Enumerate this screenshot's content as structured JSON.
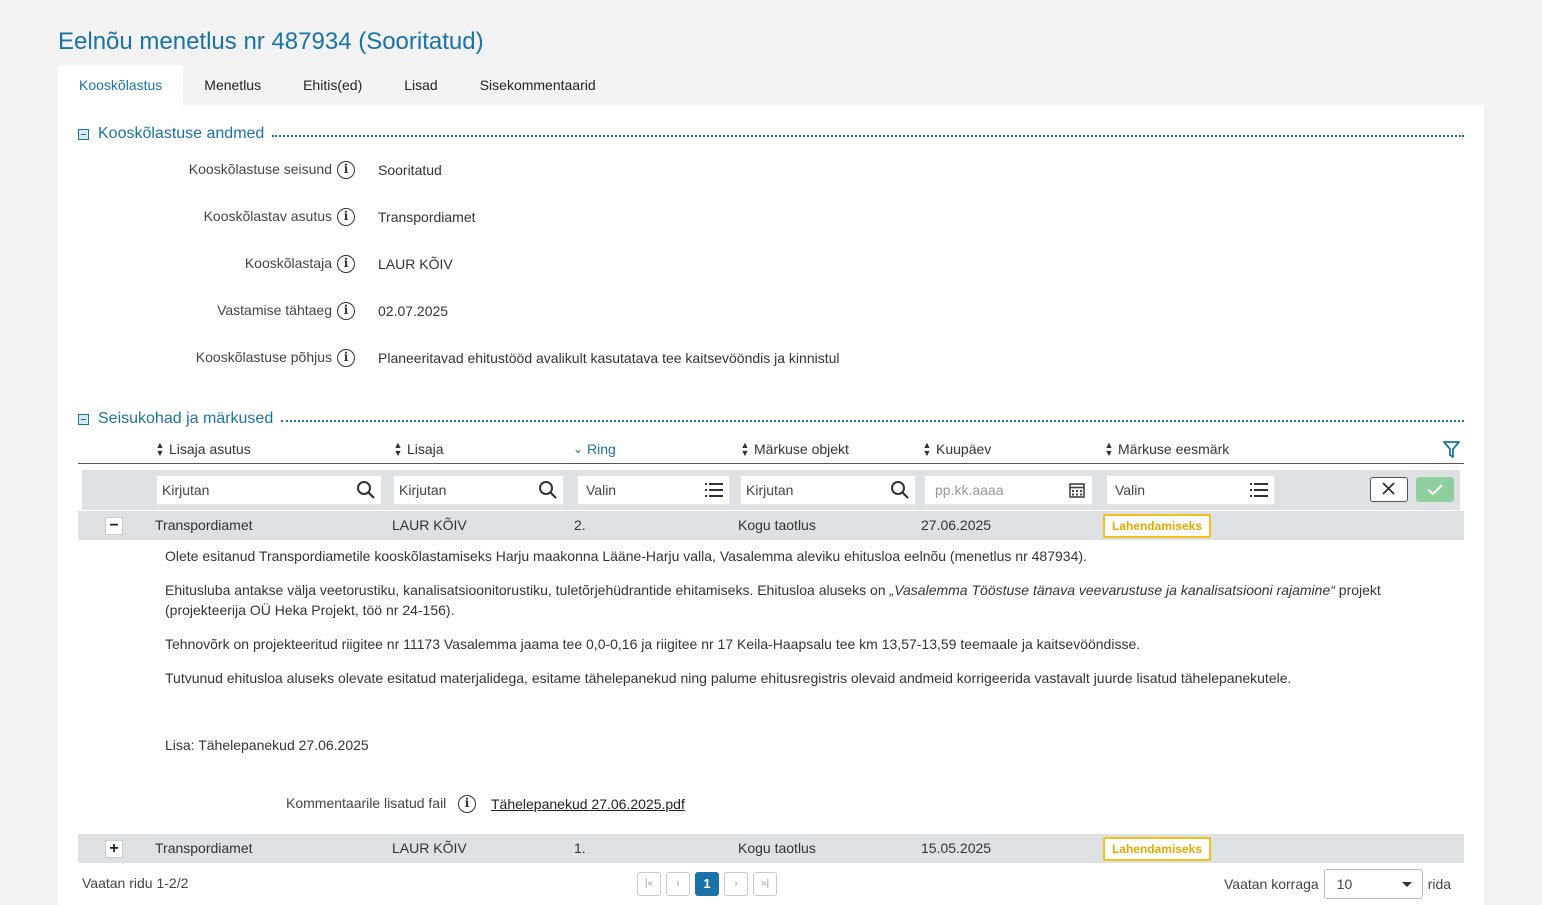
{
  "page": {
    "title": "Eelnõu menetlus nr 487934 (Sooritatud)"
  },
  "tabs": [
    {
      "label": "Kooskõlastus",
      "active": true
    },
    {
      "label": "Menetlus"
    },
    {
      "label": "Ehitis(ed)"
    },
    {
      "label": "Lisad"
    },
    {
      "label": "Sisekommentaarid"
    }
  ],
  "section1": {
    "title": "Kooskõlastuse andmed",
    "fields": [
      {
        "label": "Kooskõlastuse seisund",
        "value": "Sooritatud"
      },
      {
        "label": "Kooskõlastav asutus",
        "value": "Transpordiamet"
      },
      {
        "label": "Kooskõlastaja",
        "value": "LAUR KÕIV"
      },
      {
        "label": "Vastamise tähtaeg",
        "value": "02.07.2025"
      },
      {
        "label": "Kooskõlastuse põhjus",
        "value": "Planeeritavad ehitustööd avalikult kasutatava tee kaitsevööndis ja kinnistul"
      }
    ]
  },
  "section2": {
    "title": "Seisukohad ja märkused",
    "columns": [
      "Lisaja asutus",
      "Lisaja",
      "Ring",
      "Märkuse objekt",
      "Kuupäev",
      "Märkuse eesmärk"
    ],
    "filters": {
      "lisaja_asutus": "Kirjutan",
      "lisaja": "Kirjutan",
      "ring": "Valin",
      "objekt": "Kirjutan",
      "kuupaev_placeholder": "pp.kk.aaaa",
      "eesmark": "Valin"
    },
    "rows": [
      {
        "toggle": "−",
        "asutus": "Transpordiamet",
        "lisaja": "LAUR KÕIV",
        "ring": "2.",
        "objekt": "Kogu taotlus",
        "kuupaev": "27.06.2025",
        "eesmark": "Lahendamiseks"
      },
      {
        "toggle": "+",
        "asutus": "Transpordiamet",
        "lisaja": "LAUR KÕIV",
        "ring": "1.",
        "objekt": "Kogu taotlus",
        "kuupaev": "15.05.2025",
        "eesmark": "Lahendamiseks"
      }
    ],
    "detail": {
      "p1": "Olete esitanud Transpordiametile kooskõlastamiseks Harju maakonna Lääne-Harju valla, Vasalemma aleviku ehitusloa eelnõu (menetlus nr 487934).",
      "p2_before": "Ehitusluba antakse välja veetorustiku, kanalisatsioonitorustiku, tuletõrjehüdrantide ehitamiseks. Ehitusloa aluseks on ",
      "p2_italic": "„Vasalemma Tööstuse tänava veevarustuse ja kanalisatsiooni rajamine“",
      "p2_after": " projekt",
      "p2_line2": "(projekteerija OÜ Heka Projekt, töö nr 24-156).",
      "p3": "Tehnovõrk on projekteeritud riigitee nr 11173 Vasalemma jaama tee 0,0-0,16 ja riigitee nr 17 Keila-Haapsalu tee km 13,57-13,59 teemaale ja kaitsevööndisse.",
      "p4": "Tutvunud ehitusloa aluseks olevate esitatud materjalidega, esitame tähelepanekud ning palume ehitusregistris olevaid andmeid korrigeerida vastavalt juurde lisatud tähelepanekutele.",
      "p5": "Lisa: Tähelepanekud 27.06.2025",
      "attach_label": "Kommentaarile lisatud fail",
      "attach_file": "Tähelepanekud 27.06.2025.pdf"
    }
  },
  "footer": {
    "rows_info": "Vaatan ridu 1-2/2",
    "current_page": "1",
    "pager_first": "|«",
    "pager_prev": "‹",
    "pager_next": "›",
    "pager_last": "»|",
    "page_size_label": "Vaatan korraga",
    "page_size": "10",
    "page_size_suffix": "rida"
  },
  "colors": {
    "accent": "#1a73a8",
    "badge": "#f2c21b",
    "apply": "#8fcf9f"
  }
}
